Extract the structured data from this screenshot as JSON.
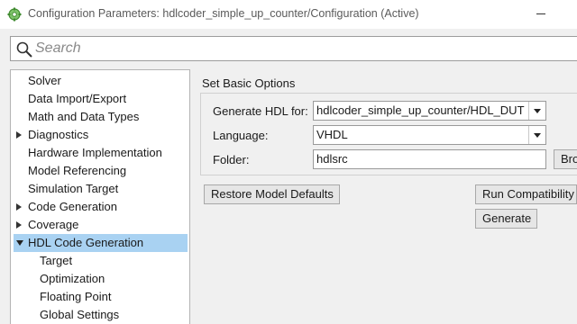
{
  "window": {
    "title": "Configuration Parameters: hdlcoder_simple_up_counter/Configuration (Active)",
    "app_icon": "matlab-gear-icon"
  },
  "search": {
    "placeholder": "Search",
    "value": ""
  },
  "tree": {
    "items": [
      {
        "label": "Solver",
        "expandable": false
      },
      {
        "label": "Data Import/Export",
        "expandable": false
      },
      {
        "label": "Math and Data Types",
        "expandable": false
      },
      {
        "label": "Diagnostics",
        "expandable": true,
        "expanded": false
      },
      {
        "label": "Hardware Implementation",
        "expandable": false
      },
      {
        "label": "Model Referencing",
        "expandable": false
      },
      {
        "label": "Simulation Target",
        "expandable": false
      },
      {
        "label": "Code Generation",
        "expandable": true,
        "expanded": false
      },
      {
        "label": "Coverage",
        "expandable": true,
        "expanded": false
      },
      {
        "label": "HDL Code Generation",
        "expandable": true,
        "expanded": true,
        "selected": true
      },
      {
        "label": "Target",
        "child": true
      },
      {
        "label": "Optimization",
        "child": true
      },
      {
        "label": "Floating Point",
        "child": true
      },
      {
        "label": "Global Settings",
        "child": true
      }
    ]
  },
  "main": {
    "section_title": "Set Basic Options",
    "generate_hdl_for": {
      "label": "Generate HDL for:",
      "value": "hdlcoder_simple_up_counter/HDL_DUT"
    },
    "language": {
      "label": "Language:",
      "value": "VHDL"
    },
    "folder": {
      "label": "Folder:",
      "value": "hdlsrc",
      "browse_label": "Browse"
    },
    "restore_defaults_label": "Restore Model Defaults",
    "run_compat_label": "Run Compatibility Checker",
    "generate_label": "Generate"
  },
  "colors": {
    "selection": "#a9d2f2",
    "icon_green": "#4a9a3a"
  }
}
